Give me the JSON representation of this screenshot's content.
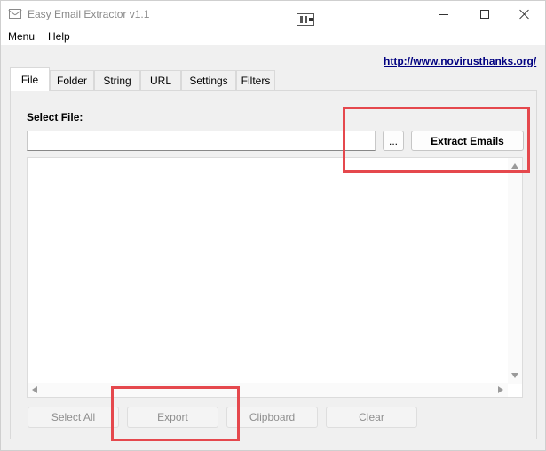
{
  "window": {
    "title": "Easy Email Extractor v1.1",
    "controls": [
      "minimize",
      "maximize",
      "close"
    ]
  },
  "menu": {
    "items": [
      "Menu",
      "Help"
    ]
  },
  "link": {
    "text": "http://www.novirusthanks.org/"
  },
  "tabs": [
    {
      "label": "File",
      "active": true
    },
    {
      "label": "Folder",
      "active": false
    },
    {
      "label": "String",
      "active": false
    },
    {
      "label": "URL",
      "active": false
    },
    {
      "label": "Settings",
      "active": false
    },
    {
      "label": "Filters",
      "active": false
    }
  ],
  "file_tab": {
    "select_label": "Select File:",
    "file_path_value": "",
    "browse_label": "...",
    "extract_label": "Extract Emails"
  },
  "actions": {
    "select_all": "Select All",
    "export": "Export",
    "clipboard": "Clipboard",
    "clear": "Clear"
  },
  "colors": {
    "highlight": "#e5484d",
    "link": "#000080",
    "disabled_text": "#8f8f8f"
  }
}
